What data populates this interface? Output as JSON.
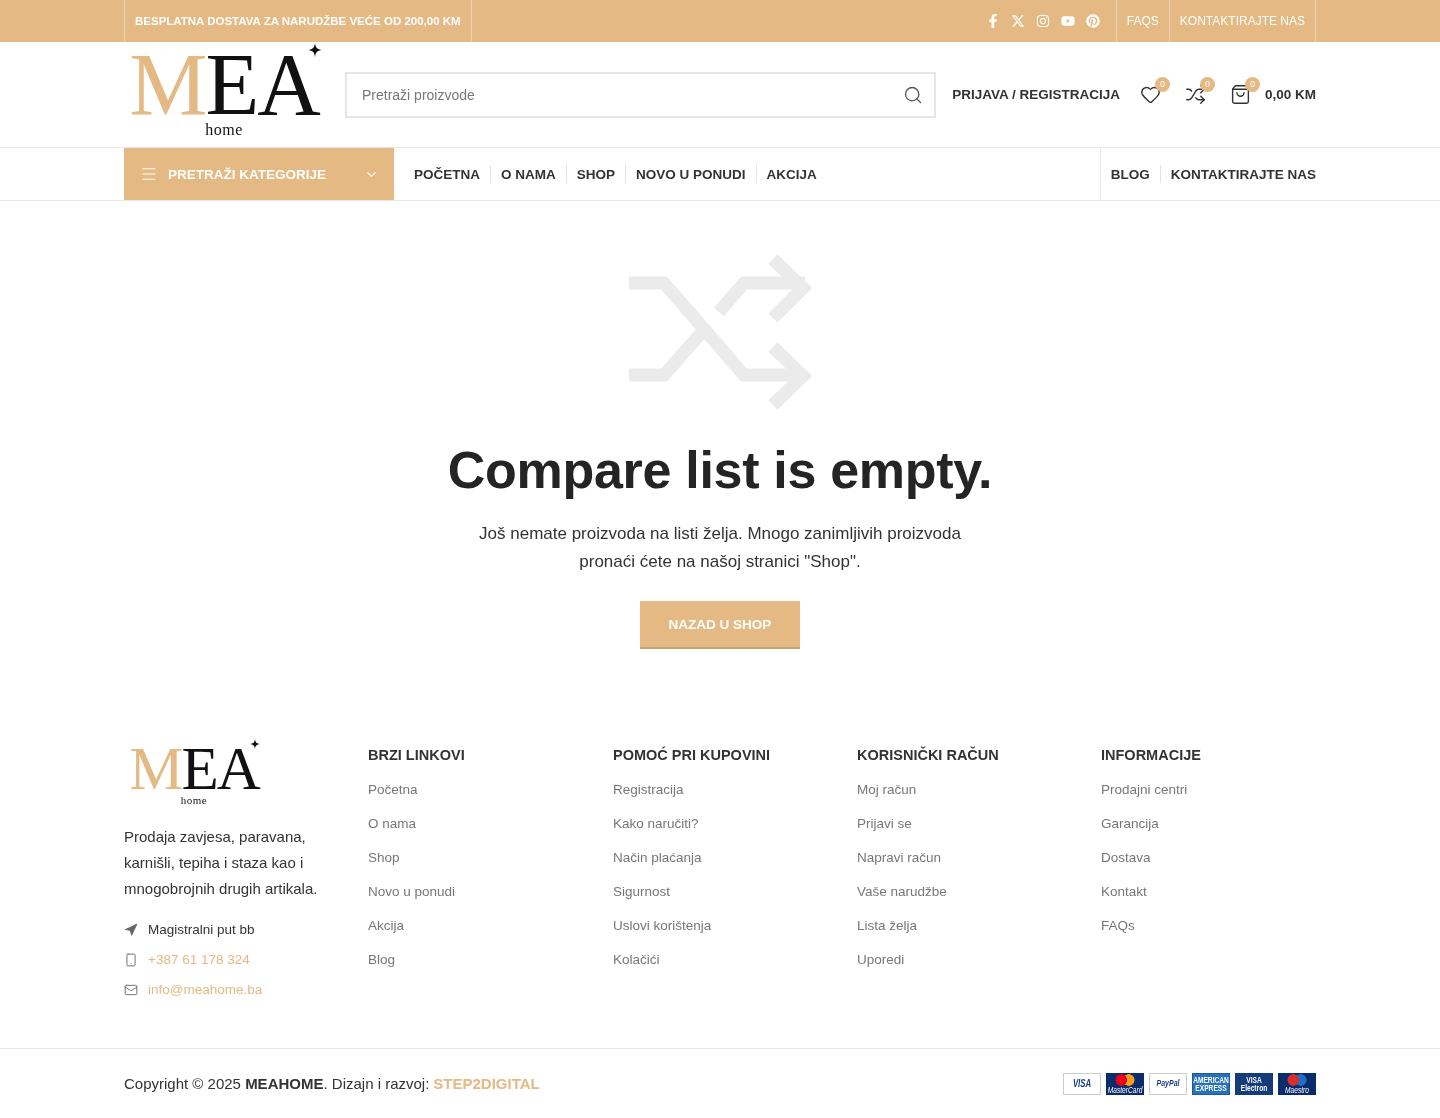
{
  "top_bar": {
    "promo": "BESPLATNA DOSTAVA ZA NARUDŽBE VEĆE OD 200,00 KM",
    "links": [
      "FAQS",
      "KONTAKTIRAJTE NAS"
    ]
  },
  "header": {
    "logo": {
      "accent": "M",
      "main": "EA",
      "sub": "home"
    },
    "search": {
      "placeholder": "Pretraži proizvode"
    },
    "account_link": "PRIJAVA / REGISTRACIJA",
    "wishlist_count": "0",
    "compare_count": "0",
    "cart_count": "0",
    "cart_total": "0,00 KM"
  },
  "nav": {
    "categories_button": "PRETRAŽI KATEGORIJE",
    "items": [
      "POČETNA",
      "O NAMA",
      "SHOP",
      "NOVO U PONUDI",
      "AKCIJA"
    ],
    "right_items": [
      "BLOG",
      "KONTAKTIRAJTE NAS"
    ]
  },
  "empty_state": {
    "title": "Compare list is empty.",
    "message": "Još nemate proizvoda na listi želja. Mnogo zanimljivih proizvoda pronaći ćete na našoj stranici \"Shop\".",
    "button": "NAZAD U SHOP"
  },
  "footer": {
    "logo": {
      "accent": "M",
      "main": "EA",
      "sub": "home"
    },
    "description": "Prodaja zavjesa, paravana, karnišli, tepiha i staza kao i mnogobrojnih drugih artikala.",
    "contacts": [
      {
        "kind": "address",
        "text": "Magistralni put bb"
      },
      {
        "kind": "phone",
        "text": "+387 61 178 324"
      },
      {
        "kind": "email",
        "text": "info@meahome.ba"
      }
    ],
    "columns": [
      {
        "title": "BRZI LINKOVI",
        "links": [
          "Početna",
          "O nama",
          "Shop",
          "Novo u ponudi",
          "Akcija",
          "Blog"
        ]
      },
      {
        "title": "POMOĆ PRI KUPOVINI",
        "links": [
          "Registracija",
          "Kako naručiti?",
          "Način plaćanja",
          "Sigurnost",
          "Uslovi korištenja",
          "Kolačići"
        ]
      },
      {
        "title": "KORISNIČKI RAČUN",
        "links": [
          "Moj račun",
          "Prijavi se",
          "Napravi račun",
          "Vaše narudžbe",
          "Lista želja",
          "Uporedi"
        ]
      },
      {
        "title": "INFORMACIJE",
        "links": [
          "Prodajni centri",
          "Garancija",
          "Dostava",
          "Kontakt",
          "FAQs"
        ]
      }
    ]
  },
  "bottom_bar": {
    "copyright": "Copyright © 2025 **MEAHOME**. Dizajn i razvoj:",
    "credit": "STEP2DIGITAL",
    "payment_logos": [
      {
        "kind": "visa",
        "label": "VISA"
      },
      {
        "kind": "mastercard",
        "label": "MasterCard"
      },
      {
        "kind": "paypal",
        "label": "PayPal"
      },
      {
        "kind": "amex",
        "label": "AMERICAN EXPRESS"
      },
      {
        "kind": "visa_electron",
        "label": "VISA Electron"
      },
      {
        "kind": "maestro",
        "label": "Maestro"
      }
    ]
  }
}
